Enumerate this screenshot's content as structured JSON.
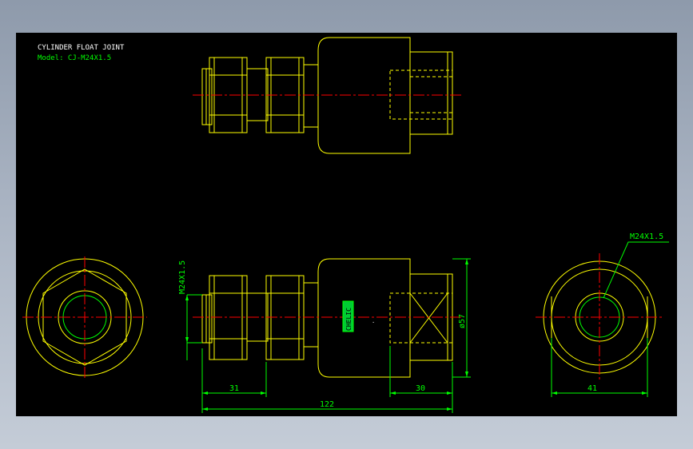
{
  "drawing": {
    "title": "CYLINDER FLOAT JOINT",
    "model": "Model: CJ-M24X1.5",
    "logo_text": "CHELIC",
    "colors": {
      "background": "#000000",
      "outline": "#ffff00",
      "center_line": "#ff0000",
      "dimension": "#00ff00",
      "hidden_line": "#ffff00",
      "text": "#ffffff",
      "frame": "#8e9aab"
    }
  },
  "dimensions": {
    "nut_width": "31",
    "thread_depth": "30",
    "overall_length": "122",
    "body_diameter": "ø57",
    "end_view_width": "41",
    "thread_left": "M24X1.5",
    "thread_callout": "M24X1.5"
  }
}
